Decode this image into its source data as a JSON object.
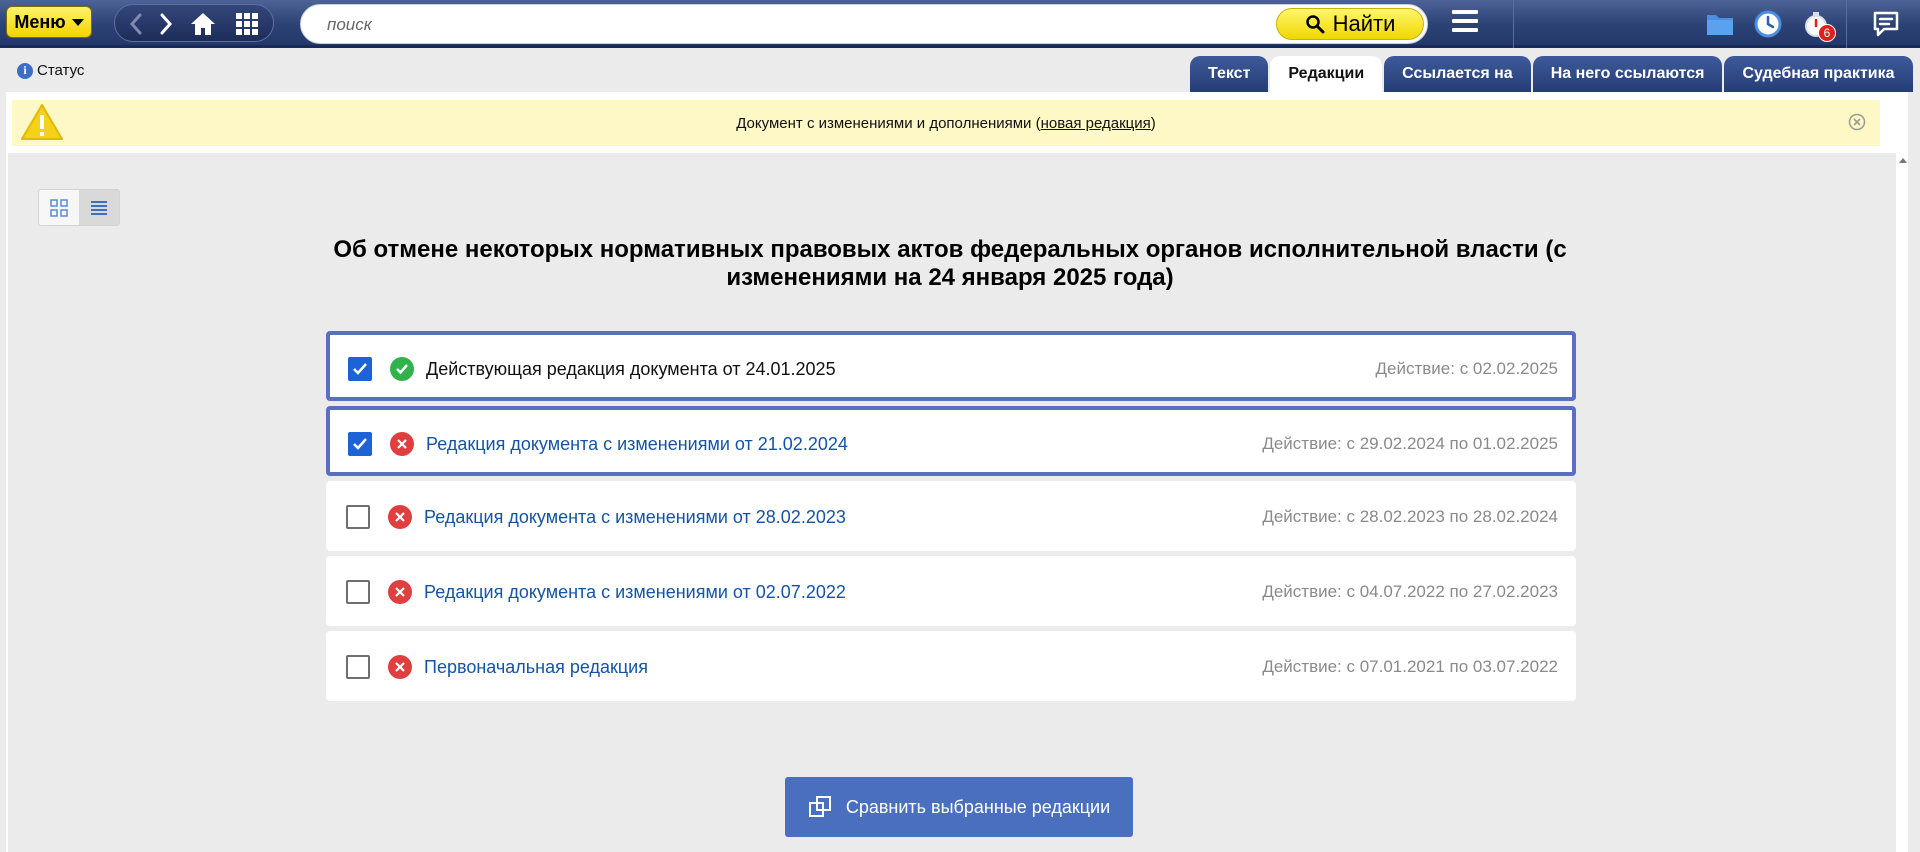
{
  "topbar": {
    "menu_label": "Меню",
    "search_placeholder": "поиск",
    "find_label": "Найти",
    "notifications_count": "6"
  },
  "status": {
    "label": "Статус"
  },
  "tabs": [
    {
      "label": "Текст",
      "active": false
    },
    {
      "label": "Редакции",
      "active": true
    },
    {
      "label": "Ссылается на",
      "active": false
    },
    {
      "label": "На него ссылаются",
      "active": false
    },
    {
      "label": "Судебная практика",
      "active": false
    }
  ],
  "warning": {
    "text_before": "Документ с изменениями и дополнениями (",
    "link": "новая редакция",
    "text_after": ")"
  },
  "document": {
    "title": "Об отмене некоторых нормативных правовых актов федеральных органов исполнительной власти (с изменениями на 24 января 2025 года)"
  },
  "editions": [
    {
      "label": "Действующая редакция документа от 24.01.2025",
      "period": "Действие: с 02.02.2025",
      "checked": true,
      "status": "valid"
    },
    {
      "label": "Редакция документа с изменениями от 21.02.2024",
      "period": "Действие: с 29.02.2024 по 01.02.2025",
      "checked": true,
      "status": "invalid"
    },
    {
      "label": "Редакция документа с изменениями от 28.02.2023",
      "period": "Действие: с 28.02.2023 по 28.02.2024",
      "checked": false,
      "status": "invalid"
    },
    {
      "label": "Редакция документа с изменениями от 02.07.2022",
      "period": "Действие: с 04.07.2022 по 27.02.2023",
      "checked": false,
      "status": "invalid"
    },
    {
      "label": "Первоначальная редакция",
      "period": "Действие: с 07.01.2021 по 03.07.2022",
      "checked": false,
      "status": "invalid"
    }
  ],
  "compare_button": {
    "label": "Сравнить выбранные редакции"
  },
  "colors": {
    "accent_blue": "#4a6fbf",
    "selected_border": "#5b6fc0",
    "link": "#1554a5",
    "valid": "#2fb34a",
    "invalid": "#df3f3f",
    "warning_bg": "#fdf8c5",
    "yellow_button": "#f2d300"
  }
}
